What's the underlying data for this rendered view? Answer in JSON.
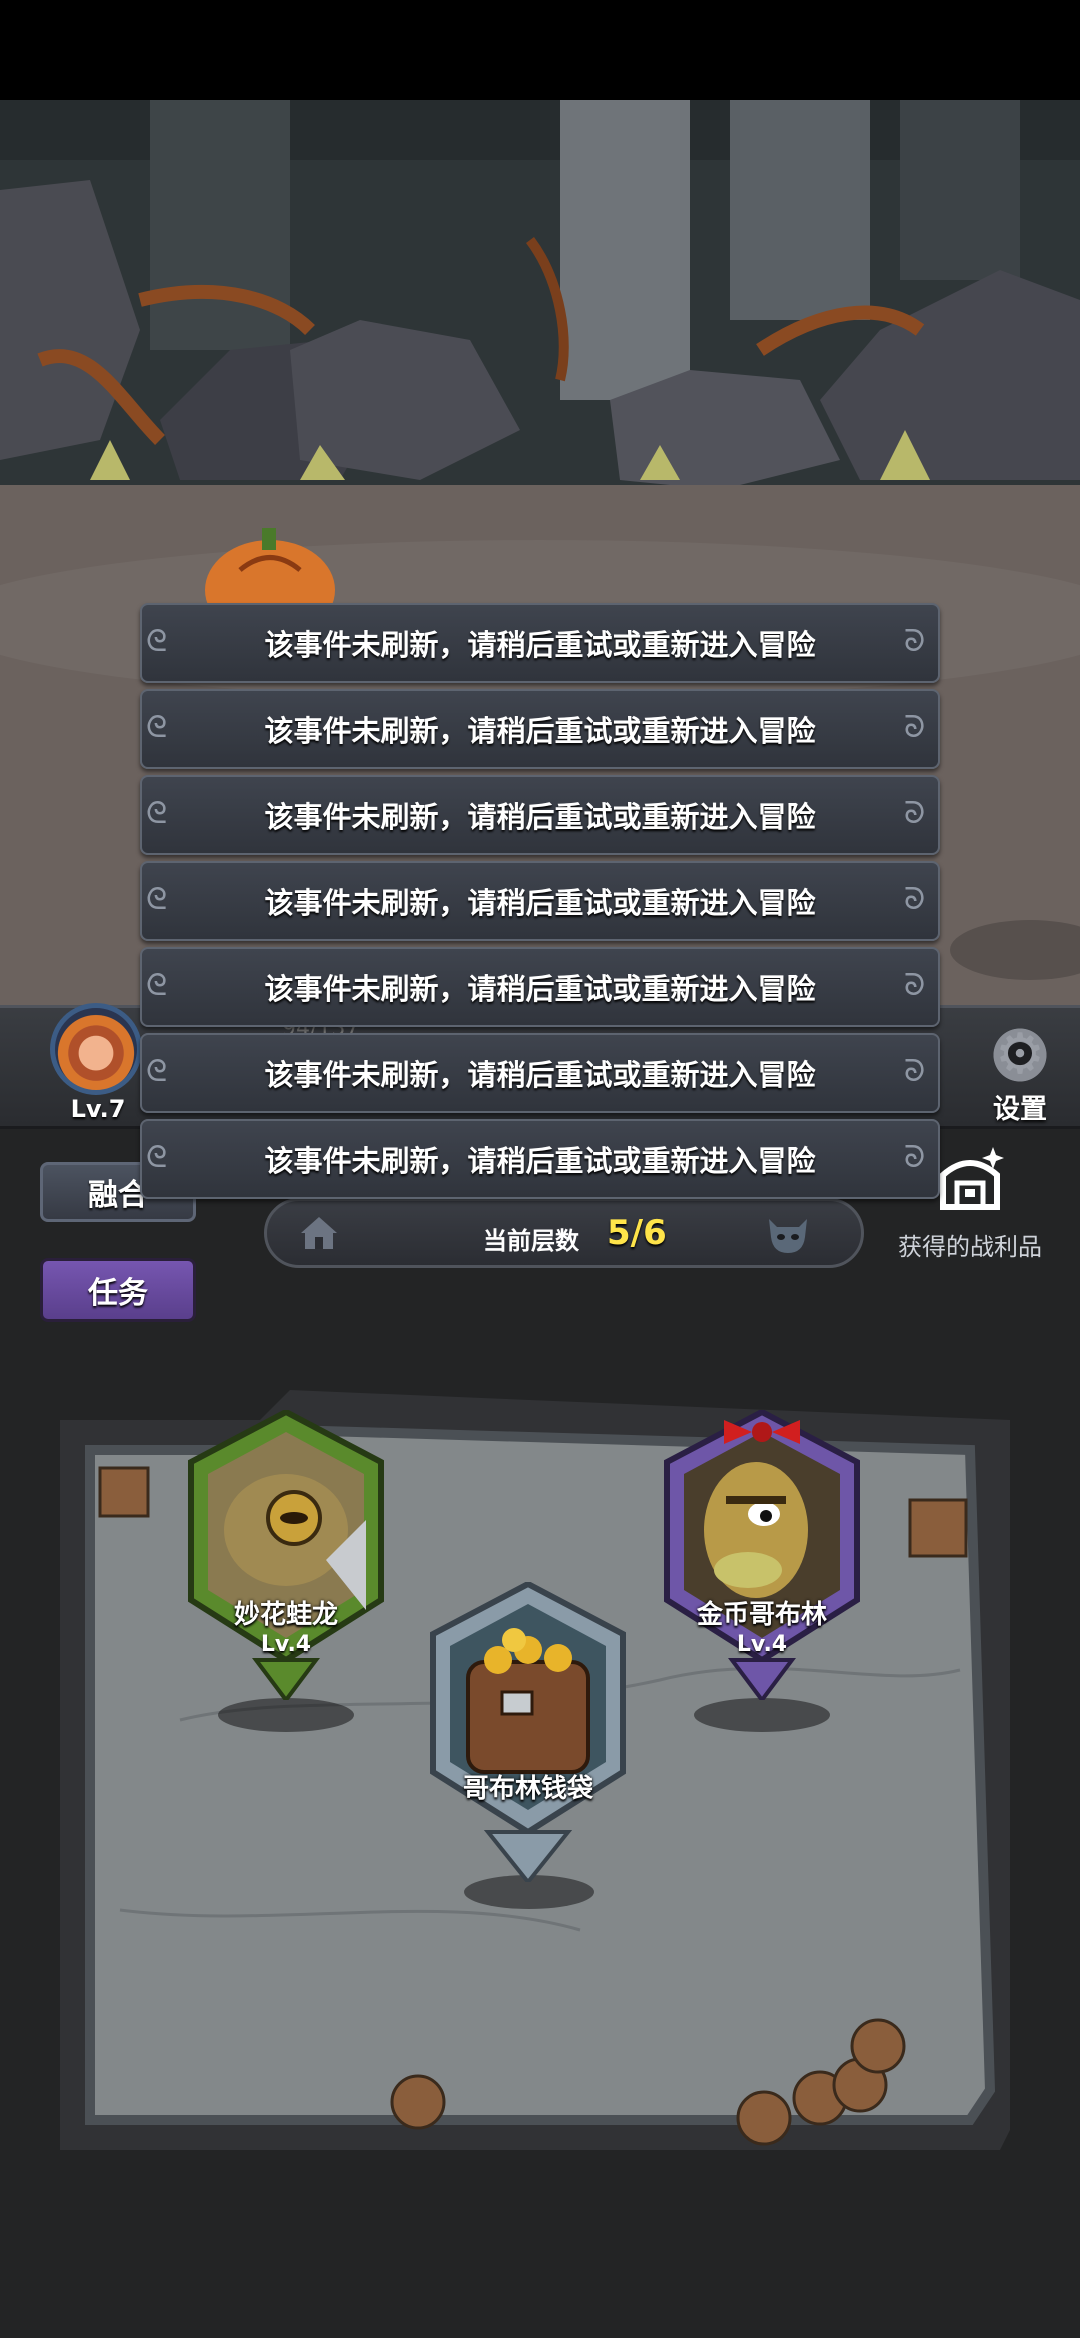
{
  "player": {
    "level": "Lv.7",
    "hp": "94/137"
  },
  "settings": {
    "label": "设置"
  },
  "buttons": {
    "merge": "融合",
    "task": "任务"
  },
  "floor": {
    "label": "当前层数",
    "value": "5/6"
  },
  "loot": {
    "label": "获得的战利品"
  },
  "nodes": [
    {
      "name": "妙花蛙龙",
      "level": "Lv.4",
      "icon": "toad-dragon-portrait"
    },
    {
      "name": "哥布林钱袋",
      "level": "",
      "icon": "goblin-money-bag"
    },
    {
      "name": "金币哥布林",
      "level": "Lv.4",
      "icon": "gold-goblin-portrait"
    }
  ],
  "toasts": [
    "该事件未刷新，请稍后重试或重新进入冒险",
    "该事件未刷新，请稍后重试或重新进入冒险",
    "该事件未刷新，请稍后重试或重新进入冒险",
    "该事件未刷新，请稍后重试或重新进入冒险",
    "该事件未刷新，请稍后重试或重新进入冒险",
    "该事件未刷新，请稍后重试或重新进入冒险",
    "该事件未刷新，请稍后重试或重新进入冒险"
  ],
  "colors": {
    "accent_yellow": "#ffe44a",
    "task_purple": "#6a4aa0",
    "green_badge": "#5a8a2c",
    "purple_badge": "#6e56a8"
  }
}
